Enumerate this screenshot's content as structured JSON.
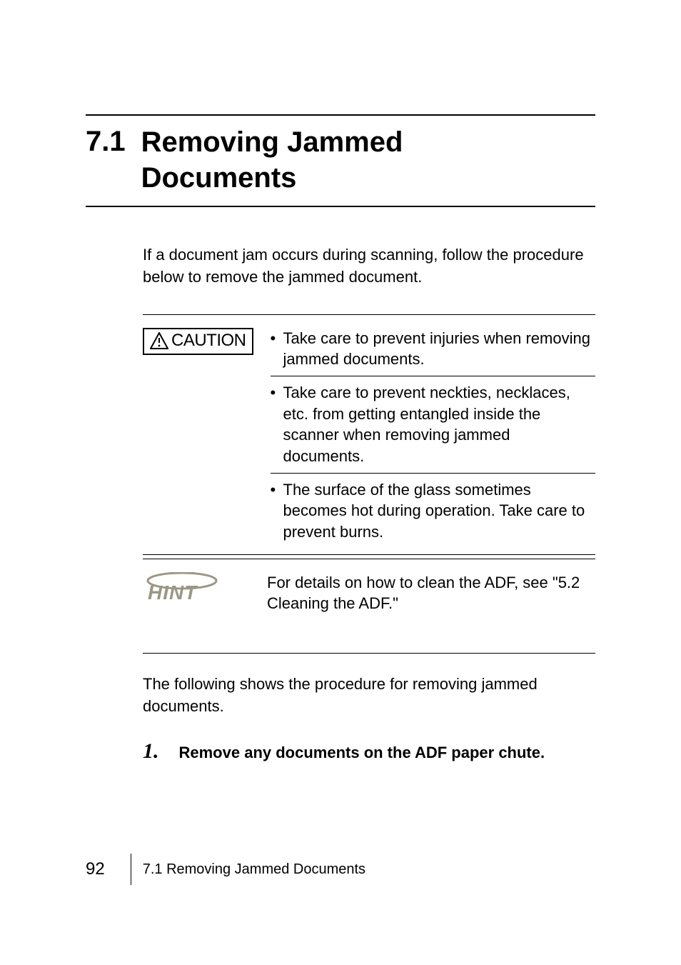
{
  "section": {
    "number": "7.1",
    "title_line1": "Removing Jammed",
    "title_line2": "Documents"
  },
  "intro": "If a document jam occurs during scanning, follow the procedure below to remove the jammed document.",
  "caution": {
    "label": "CAUTION",
    "items": [
      "Take care to prevent injuries when removing jammed documents.",
      "Take care to prevent neckties, necklaces, etc. from getting entangled inside the scanner when removing jammed documents.",
      "The surface of the glass sometimes becomes hot during operation. Take care to prevent burns."
    ]
  },
  "hint": {
    "label": "HINT",
    "text": "For details on how to clean the ADF, see \"5.2 Cleaning the ADF.\""
  },
  "followup": "The following shows the procedure for removing jammed documents.",
  "step1": {
    "number": "1.",
    "text": "Remove any documents on the ADF paper chute."
  },
  "footer": {
    "page": "92",
    "breadcrumb": "7.1 Removing Jammed Documents"
  }
}
